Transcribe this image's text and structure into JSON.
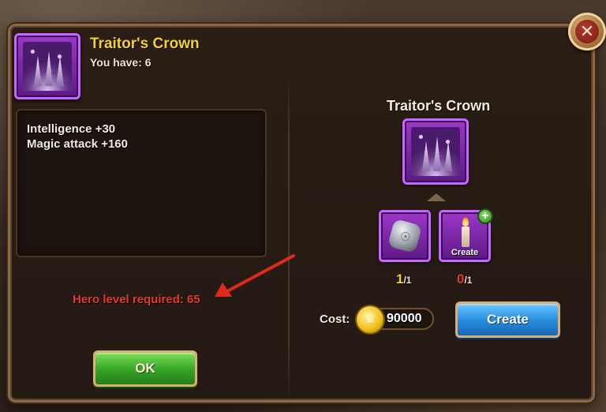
{
  "dialog": {
    "item_name": "Traitor's Crown",
    "you_have_label": "You have:",
    "you_have_count": "6",
    "stats": [
      "Intelligence +30",
      "Magic attack +160"
    ],
    "hero_level_required": "Hero level required: 65",
    "ok_label": "OK",
    "close_icon": "close-icon"
  },
  "recipe": {
    "title": "Traitor's Crown",
    "ingredients": [
      {
        "name": "stone-icon",
        "have": "1",
        "need": "/1",
        "status_color": "#f2d232"
      },
      {
        "name": "candle-icon",
        "have": "0",
        "need": "/1",
        "status_color": "#e33a2c",
        "badge_label": "Create"
      }
    ],
    "cost_label": "Cost:",
    "cost_value": "90000",
    "create_label": "Create"
  },
  "colors": {
    "title_yellow": "#f2d232",
    "warning_red": "#e33a2c",
    "ok_green": "#3aa629",
    "create_blue": "#2a8fe0",
    "epic_purple": "#c765ff"
  }
}
